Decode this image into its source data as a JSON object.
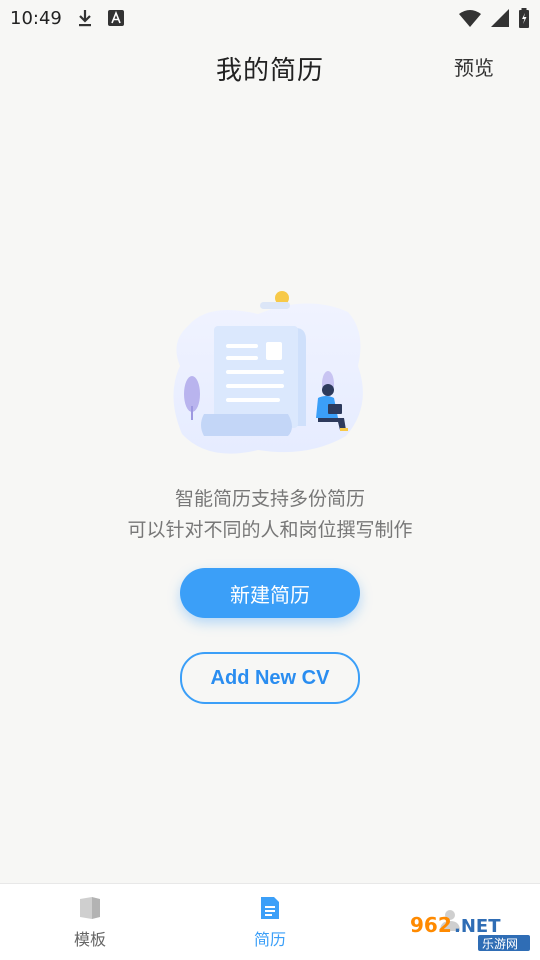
{
  "status_bar": {
    "time": "10:49"
  },
  "header": {
    "title": "我的简历",
    "preview_label": "预览"
  },
  "empty_state": {
    "line1": "智能简历支持多份简历",
    "line2": "可以针对不同的人和岗位撰写制作"
  },
  "actions": {
    "new_cv_label": "新建简历",
    "add_cv_label": "Add New CV"
  },
  "bottom_nav": {
    "items": [
      {
        "label": "模板",
        "icon": "template-icon",
        "active": false
      },
      {
        "label": "简历",
        "icon": "document-icon",
        "active": true
      },
      {
        "label": "",
        "icon": "profile-icon",
        "active": false
      }
    ]
  },
  "watermark": {
    "brand": "962.NET",
    "tagline": "乐游网"
  },
  "colors": {
    "accent": "#3b9ff8",
    "background": "#f7f7f5"
  }
}
